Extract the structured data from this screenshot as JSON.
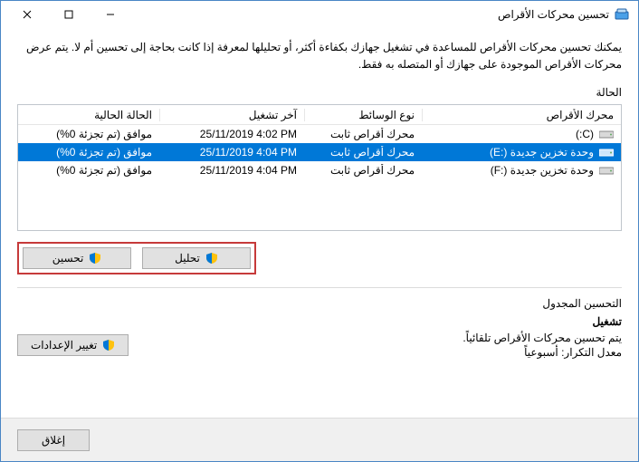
{
  "window": {
    "title": "تحسين محركات الأقراص"
  },
  "intro": "يمكنك تحسين محركات الأقراص للمساعدة في تشغيل جهازك بكفاءة أكثر، أو تحليلها لمعرفة إذا كانت بحاجة إلى تحسين أم لا. يتم عرض محركات الأقراص الموجودة على جهازك أو المتصله به فقط.",
  "labels": {
    "state": "الحالة",
    "col_drive": "محرك الأقراص",
    "col_media": "نوع الوسائط",
    "col_lastrun": "آخر تشغيل",
    "col_status": "الحالة الحالية",
    "analyze": "تحليل",
    "optimize": "تحسين",
    "scheduled_heading": "التحسين المجدول",
    "on": "تشغيل",
    "sched_line1": "يتم تحسين محركات الأقراص تلقائياً.",
    "sched_line2_prefix": "معدل التكرار: ",
    "sched_freq": "أسبوعياً",
    "change_settings": "تغيير الإعدادات",
    "close": "إغلاق"
  },
  "drives": [
    {
      "name": "(C:)",
      "media": "محرك أقراص ثابت",
      "lastrun": "25/11/2019 4:02 PM",
      "status": "موافق (تم تجزئة 0%)",
      "selected": false
    },
    {
      "name": "وحدة تخزين جديدة (:E)",
      "media": "محرك أقراص ثابت",
      "lastrun": "25/11/2019 4:04 PM",
      "status": "موافق (تم تجزئة 0%)",
      "selected": true
    },
    {
      "name": "وحدة تخزين جديدة (:F)",
      "media": "محرك أقراص ثابت",
      "lastrun": "25/11/2019 4:04 PM",
      "status": "موافق (تم تجزئة 0%)",
      "selected": false
    }
  ]
}
